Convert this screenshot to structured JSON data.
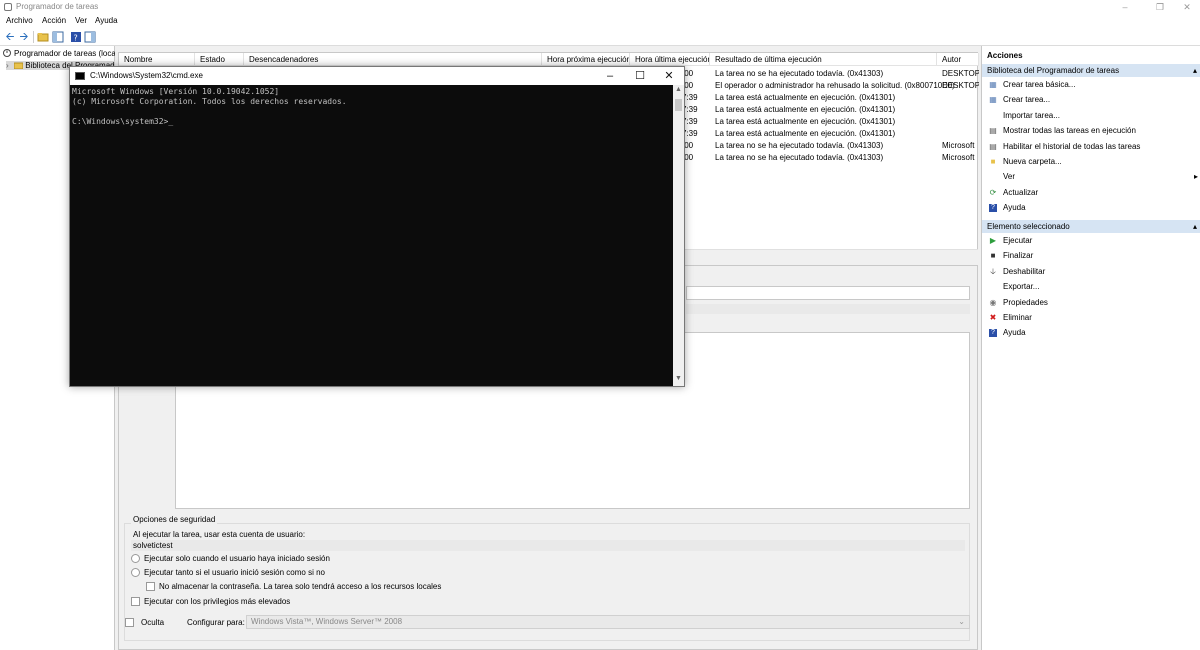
{
  "window": {
    "title": "Programador de tareas"
  },
  "menu": [
    "Archivo",
    "Acción",
    "Ver",
    "Ayuda"
  ],
  "tree": {
    "root": "Programador de tareas (local",
    "library": "Biblioteca del Programad"
  },
  "tasklist": {
    "columns": [
      "Nombre",
      "Estado",
      "Desencadenadores",
      "Hora próxima ejecución",
      "Hora última ejecución",
      "Resultado de última ejecución",
      "Autor"
    ],
    "rows": [
      {
        "time": ":00",
        "result": "La tarea no se ha ejecutado todavía. (0x41303)",
        "author": "DESKTOP-"
      },
      {
        "time": ":00",
        "result": "El operador o administrador ha rehusado la solicitud. (0x800710E0)",
        "author": "DESKTOP-"
      },
      {
        "time": "7:39",
        "result": "La tarea está actualmente en ejecución. (0x41301)",
        "author": ""
      },
      {
        "time": "7:39",
        "result": "La tarea está actualmente en ejecución. (0x41301)",
        "author": ""
      },
      {
        "time": "7:39",
        "result": "La tarea está actualmente en ejecución. (0x41301)",
        "author": ""
      },
      {
        "time": "7:39",
        "result": "La tarea está actualmente en ejecución. (0x41301)",
        "author": ""
      },
      {
        "time": ":00",
        "result": "La tarea no se ha ejecutado todavía. (0x41303)",
        "author": "Microsoft"
      },
      {
        "time": ":00",
        "result": "La tarea no se ha ejecutado todavía. (0x41303)",
        "author": "Microsoft"
      }
    ]
  },
  "security": {
    "group_label": "Opciones de seguridad",
    "run_as_label": "Al ejecutar la tarea, usar esta cuenta de usuario:",
    "account": "solvetictest",
    "radio_logged_on": "Ejecutar solo cuando el usuario haya iniciado sesión",
    "radio_whether": "Ejecutar tanto si el usuario inició sesión como si no",
    "no_store_password": "No almacenar la contraseña. La tarea solo tendrá acceso a los recursos locales",
    "highest_privileges": "Ejecutar con los privilegios más elevados",
    "hidden": "Oculta",
    "configure_for_label": "Configurar para:",
    "configure_for_value": "Windows Vista™, Windows Server™ 2008"
  },
  "actions": {
    "header": "Acciones",
    "section1": "Biblioteca del Programador de tareas",
    "section1_items": [
      {
        "icon": "create-basic-task-icon",
        "label": "Crear tarea básica..."
      },
      {
        "icon": "create-task-icon",
        "label": "Crear tarea..."
      },
      {
        "icon": "",
        "label": "Importar tarea..."
      },
      {
        "icon": "running-tasks-icon",
        "label": "Mostrar todas las tareas en ejecución"
      },
      {
        "icon": "history-icon",
        "label": "Habilitar el historial de todas las tareas"
      },
      {
        "icon": "new-folder-icon",
        "label": "Nueva carpeta..."
      },
      {
        "icon": "",
        "label": "Ver"
      },
      {
        "icon": "refresh-icon",
        "label": "Actualizar"
      },
      {
        "icon": "help-icon",
        "label": "Ayuda"
      }
    ],
    "section2": "Elemento seleccionado",
    "section2_items": [
      {
        "icon": "run-icon",
        "label": "Ejecutar"
      },
      {
        "icon": "stop-icon",
        "label": "Finalizar"
      },
      {
        "icon": "disable-icon",
        "label": "Deshabilitar"
      },
      {
        "icon": "",
        "label": "Exportar..."
      },
      {
        "icon": "properties-icon",
        "label": "Propiedades"
      },
      {
        "icon": "delete-icon",
        "label": "Eliminar"
      },
      {
        "icon": "help-icon",
        "label": "Ayuda"
      }
    ]
  },
  "cmd": {
    "title": "C:\\Windows\\System32\\cmd.exe",
    "line1": "Microsoft Windows [Versión 10.0.19042.1052]",
    "line2": "(c) Microsoft Corporation. Todos los derechos reservados.",
    "prompt": "C:\\Windows\\system32>"
  }
}
